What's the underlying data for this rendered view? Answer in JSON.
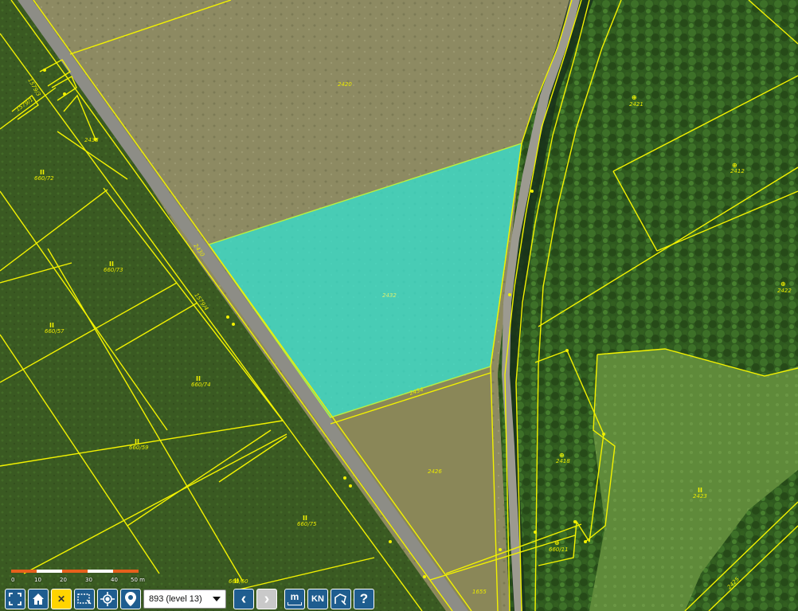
{
  "map": {
    "selected_parcel": "2432",
    "parcels": [
      {
        "id": "2420",
        "label": "2420"
      },
      {
        "id": "2432",
        "label": "2432"
      },
      {
        "id": "2433",
        "label": "2433"
      },
      {
        "id": "2421",
        "label": "2421"
      },
      {
        "id": "2412",
        "label": "2412"
      },
      {
        "id": "2422",
        "label": "2422"
      },
      {
        "id": "2418",
        "label": "2418"
      },
      {
        "id": "2423",
        "label": "2423"
      },
      {
        "id": "2426",
        "label": "2426"
      },
      {
        "id": "660/72",
        "label": "660/72"
      },
      {
        "id": "660/73",
        "label": "660/73"
      },
      {
        "id": "660/57",
        "label": "660/57"
      },
      {
        "id": "660/74",
        "label": "660/74"
      },
      {
        "id": "660/59",
        "label": "660/59"
      },
      {
        "id": "660/75",
        "label": "660/75"
      },
      {
        "id": "660/60",
        "label": "660/60"
      },
      {
        "id": "660/11",
        "label": "660/11"
      },
      {
        "id": "1579/4",
        "label": "1579/4"
      },
      {
        "id": "1579/3",
        "label": "1579/3"
      },
      {
        "id": "1579/1",
        "label": "1579/1"
      },
      {
        "id": "2430",
        "label": "2430"
      },
      {
        "id": "2434",
        "label": "2434"
      },
      {
        "id": "2425",
        "label": "2425"
      },
      {
        "id": "1655",
        "label": "1655"
      }
    ],
    "land_type_symbols": {
      "arable": "II",
      "forest": "⊕"
    }
  },
  "scalebar": {
    "labels": [
      "0",
      "10",
      "20",
      "30",
      "40",
      "50 m"
    ],
    "colors": [
      "#e8601c",
      "#ffffff"
    ]
  },
  "toolbar": {
    "fullscreen_icon": "fullscreen-icon",
    "home_icon": "home-icon",
    "clear_label": "✕",
    "select_area_icon": "select-area-icon",
    "locate_icon": "locate-icon",
    "marker_icon": "map-marker-icon",
    "level_value": "893 (level 13)",
    "prev_label": "‹",
    "next_label": "›",
    "measure_label": "m",
    "kn_label": "KN",
    "draw_icon": "draw-polygon-icon",
    "help_label": "?"
  },
  "colors": {
    "parcel_line": "#f2f200",
    "selected_fill": "#2ee6d6",
    "toolbar_blue": "#1f5d8f",
    "accent_yellow": "#ffd400"
  }
}
